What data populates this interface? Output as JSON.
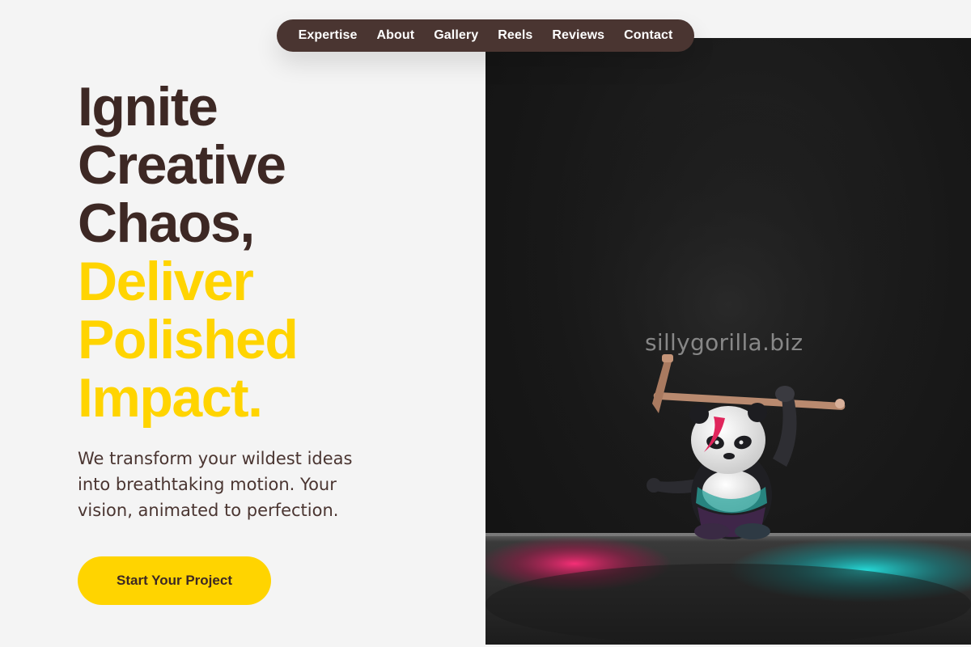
{
  "nav": {
    "items": [
      {
        "label": "Expertise"
      },
      {
        "label": "About"
      },
      {
        "label": "Gallery"
      },
      {
        "label": "Reels"
      },
      {
        "label": "Reviews"
      },
      {
        "label": "Contact"
      }
    ]
  },
  "hero": {
    "headline_dark": [
      "Ignite",
      "Creative",
      "Chaos,"
    ],
    "headline_accent": [
      "Deliver",
      "Polished",
      "Impact."
    ],
    "subtext": "We transform your wildest ideas into breathtaking motion. Your vision, animated to perfection.",
    "cta_label": "Start Your Project"
  },
  "photo": {
    "watermark": "sillygorilla.biz"
  },
  "colors": {
    "brand_dark": "#4a3531",
    "heading_dark": "#3d2824",
    "accent_yellow": "#ffd400",
    "background": "#f4f4f4"
  }
}
